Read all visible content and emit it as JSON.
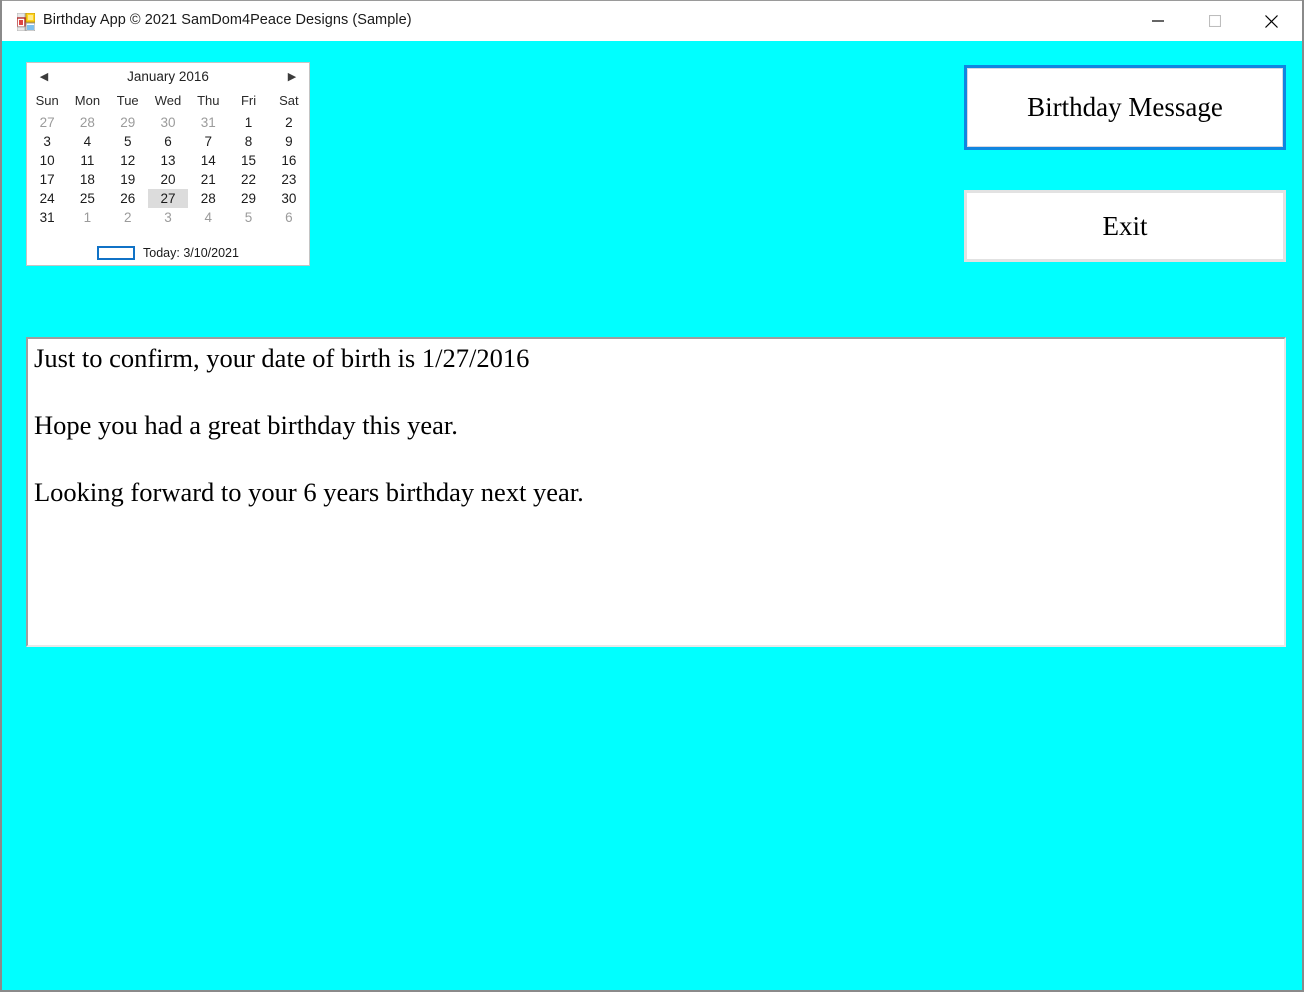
{
  "window": {
    "title": "Birthday App © 2021 SamDom4Peace Designs (Sample)",
    "icon": "winforms-app-icon",
    "background_color": "#00ffff",
    "controls": {
      "minimize": "minimize-icon",
      "maximize": "maximize-icon",
      "close": "close-icon"
    }
  },
  "calendar": {
    "prev_arrow": "◀",
    "next_arrow": "▶",
    "month_year": "January 2016",
    "weekday_headers": [
      "Sun",
      "Mon",
      "Tue",
      "Wed",
      "Thu",
      "Fri",
      "Sat"
    ],
    "weeks": [
      [
        {
          "d": "27",
          "other": true
        },
        {
          "d": "28",
          "other": true
        },
        {
          "d": "29",
          "other": true
        },
        {
          "d": "30",
          "other": true
        },
        {
          "d": "31",
          "other": true
        },
        {
          "d": "1",
          "other": false
        },
        {
          "d": "2",
          "other": false
        }
      ],
      [
        {
          "d": "3",
          "other": false
        },
        {
          "d": "4",
          "other": false
        },
        {
          "d": "5",
          "other": false
        },
        {
          "d": "6",
          "other": false
        },
        {
          "d": "7",
          "other": false
        },
        {
          "d": "8",
          "other": false
        },
        {
          "d": "9",
          "other": false
        }
      ],
      [
        {
          "d": "10",
          "other": false
        },
        {
          "d": "11",
          "other": false
        },
        {
          "d": "12",
          "other": false
        },
        {
          "d": "13",
          "other": false
        },
        {
          "d": "14",
          "other": false
        },
        {
          "d": "15",
          "other": false
        },
        {
          "d": "16",
          "other": false
        }
      ],
      [
        {
          "d": "17",
          "other": false
        },
        {
          "d": "18",
          "other": false
        },
        {
          "d": "19",
          "other": false
        },
        {
          "d": "20",
          "other": false
        },
        {
          "d": "21",
          "other": false
        },
        {
          "d": "22",
          "other": false
        },
        {
          "d": "23",
          "other": false
        }
      ],
      [
        {
          "d": "24",
          "other": false
        },
        {
          "d": "25",
          "other": false
        },
        {
          "d": "26",
          "other": false
        },
        {
          "d": "27",
          "other": false,
          "selected": true
        },
        {
          "d": "28",
          "other": false
        },
        {
          "d": "29",
          "other": false
        },
        {
          "d": "30",
          "other": false
        }
      ],
      [
        {
          "d": "31",
          "other": false
        },
        {
          "d": "1",
          "other": true
        },
        {
          "d": "2",
          "other": true
        },
        {
          "d": "3",
          "other": true
        },
        {
          "d": "4",
          "other": true
        },
        {
          "d": "5",
          "other": true
        },
        {
          "d": "6",
          "other": true
        }
      ]
    ],
    "selected_date": "27",
    "today_label": "Today: 3/10/2021",
    "today_swatch_color": "#1072c6"
  },
  "buttons": {
    "birthday_message": "Birthday Message",
    "exit": "Exit",
    "focus_border_color": "#1086e0"
  },
  "message": {
    "lines": [
      "Just to confirm, your date of birth is 1/27/2016",
      "",
      "Hope you had a great birthday this year.",
      "",
      "Looking forward to your 6 years birthday next year.",
      ""
    ]
  }
}
